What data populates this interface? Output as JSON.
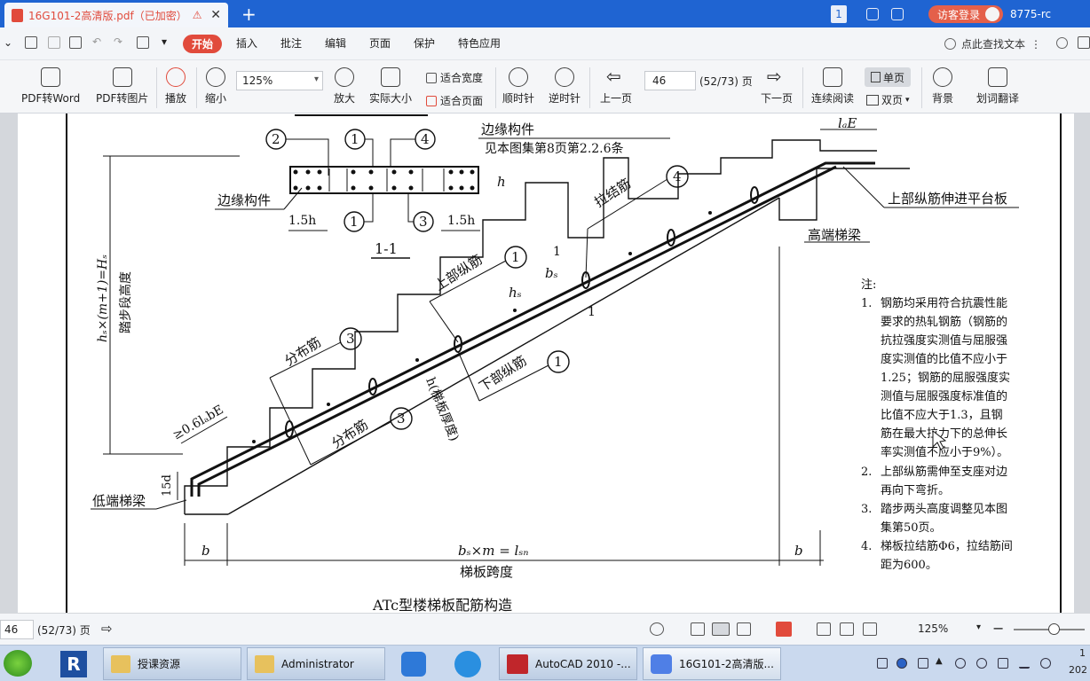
{
  "titlebar": {
    "tab_title": "16G101-2高清版.pdf（已加密）",
    "warn_icon": "⚠",
    "close": "✕",
    "new_tab": "+",
    "window_badge": "1",
    "login": "访客登录",
    "user_code": "8775-rc"
  },
  "menu": {
    "items": [
      "开始",
      "插入",
      "批注",
      "编辑",
      "页面",
      "保护",
      "特色应用"
    ],
    "search": "点此查找文本",
    "more": "⋮"
  },
  "toolbar": {
    "pdf_to_word": "PDF转Word",
    "pdf_to_image": "PDF转图片",
    "play": "播放",
    "zoom_out": "缩小",
    "zoom_value": "125%",
    "zoom_in": "放大",
    "actual_size": "实际大小",
    "fit_width": "适合宽度",
    "fit_page": "适合页面",
    "rotate_cw": "顺时针",
    "rotate_ccw": "逆时针",
    "prev_page": "上一页",
    "page_value": "46",
    "page_count": "(52/73) 页",
    "next_page": "下一页",
    "continuous": "连续阅读",
    "single": "单页",
    "double": "双页",
    "background": "背景",
    "translate": "划词翻译"
  },
  "drawing": {
    "edge_member": "边缘构件",
    "edge_member_top": "边缘构件",
    "see_ref": "见本图集第8页第2.2.6条",
    "c1": "1",
    "c2": "2",
    "c3": "3",
    "c4": "4",
    "h": "h",
    "dim_15h": "1.5h",
    "section": "1-1",
    "tie_bar": "拉结筋",
    "top_bar": "上部纵筋",
    "bottom_bar": "下部纵筋",
    "dist_bar": "分布筋",
    "slab_thk": "h(梯板厚度)",
    "high_beam": "高端梯梁",
    "low_beam": "低端梯梁",
    "top_into_platform": "上部纵筋伸进平台板",
    "lae": "lₐE",
    "bs": "bₛ",
    "hs": "hₛ",
    "cut_mark": "1",
    "anch": "≥0.6lₐbE",
    "d15": "15d",
    "height_formula": "hₛ×(m+1)=Hₛ",
    "height_label": "踏步段高度",
    "b": "b",
    "span_formula": "bₛ×m = lₛₙ",
    "span_label": "梯板跨度",
    "caption": "ATc型楼梯板配筋构造",
    "notes_title": "注:",
    "notes": [
      "1.",
      "钢筋均采用符合抗震性能",
      "要求的热轧钢筋（钢筋的",
      "抗拉强度实测值与屈服强",
      "度实测值的比值不应小于",
      "1.25；钢筋的屈服强度实",
      "测值与屈服强度标准值的",
      "比值不应大于1.3，且钢",
      "筋在最大拉力下的总伸长",
      "率实测值不应小于9%）。",
      "2.",
      "上部纵筋需伸至支座对边",
      "再向下弯折。",
      "3.",
      "踏步两头高度调整见本图",
      "集第50页。",
      "4.",
      "梯板拉结筋Φ6，拉结筋间",
      "距为600。"
    ]
  },
  "status": {
    "page_value": "46",
    "page_count": "(52/73) 页",
    "zoom": "125%",
    "minus": "−"
  },
  "taskbar": {
    "items": [
      "授课资源",
      "Administrator",
      "AutoCAD 2010 -...",
      "16G101-2高清版..."
    ],
    "clock_top": "1",
    "clock_bottom": "202"
  }
}
